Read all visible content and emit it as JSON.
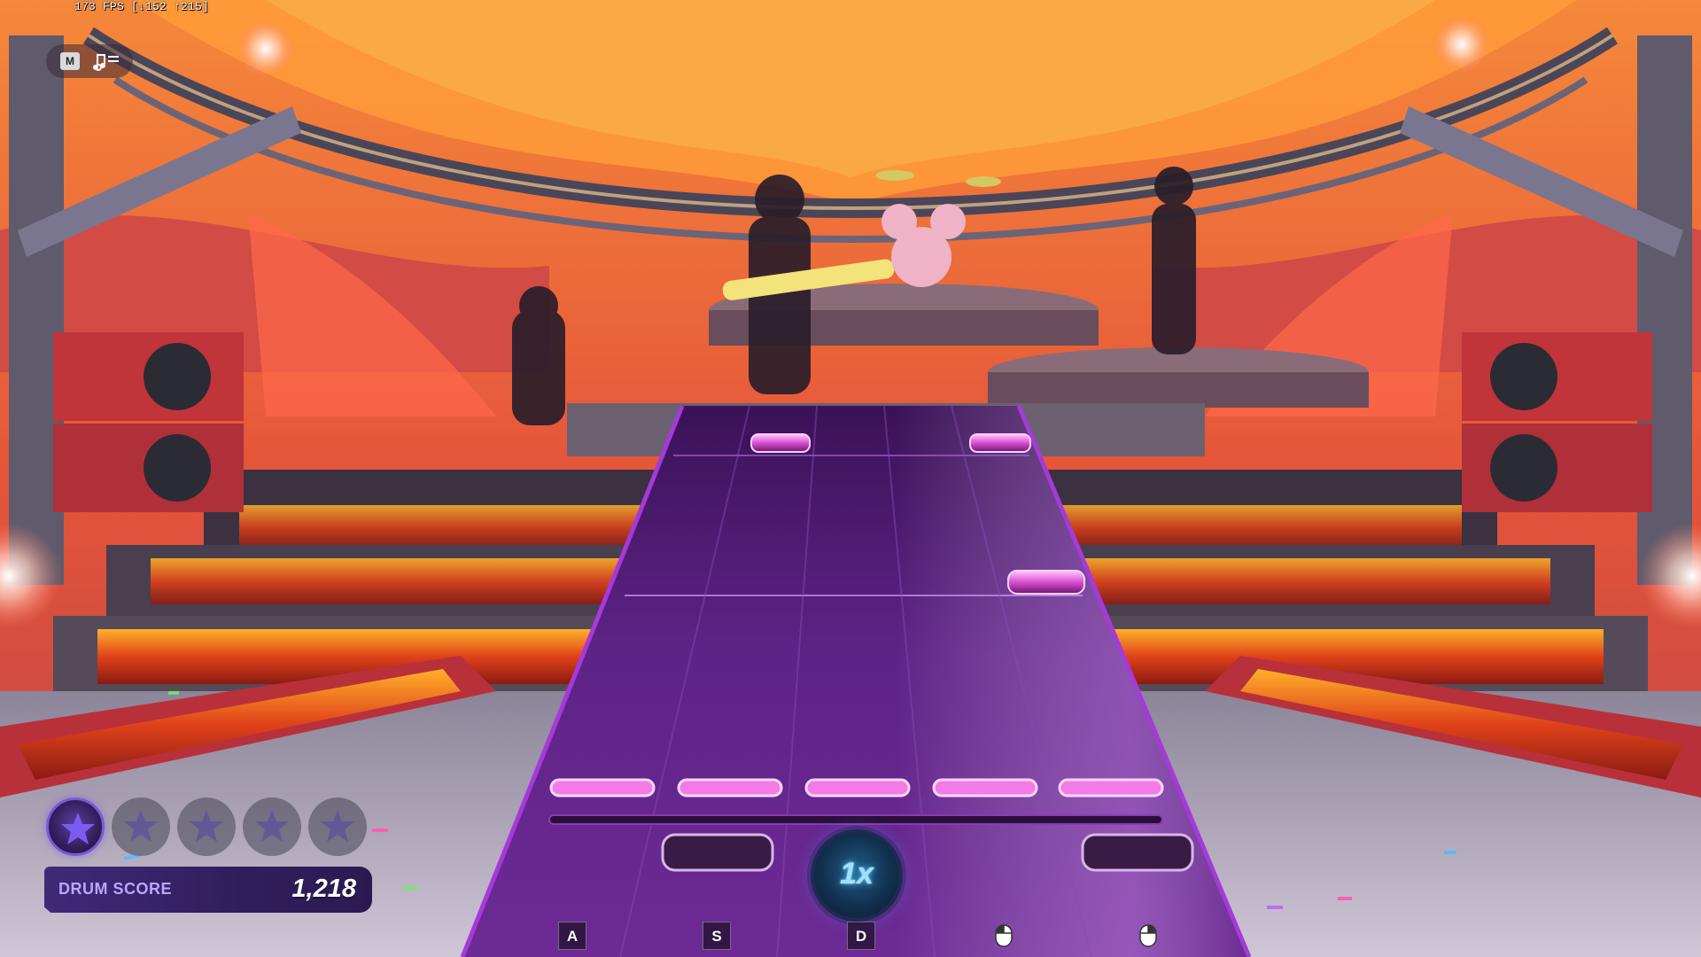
{
  "hud": {
    "fps_readout": "173 FPS [↓152 ↑215]",
    "menu_key": "M",
    "music_icon": "music-list-icon"
  },
  "stars": {
    "earned": 1,
    "total": 5,
    "icon": "star-icon"
  },
  "score": {
    "label": "DRUM SCORE",
    "value": "1,218"
  },
  "multiplier": {
    "value": "1x"
  },
  "lane_keys": [
    "A",
    "S",
    "D",
    "mouse-left-icon",
    "mouse-right-icon"
  ],
  "colors": {
    "highway": "#5a1f86",
    "note_gem": "#e45ad8",
    "strike_line": "#ff7cf2",
    "score_panel": "#3f2a78",
    "star_active": "#6c4bd2",
    "multiplier_glow": "#4fc0ff"
  }
}
